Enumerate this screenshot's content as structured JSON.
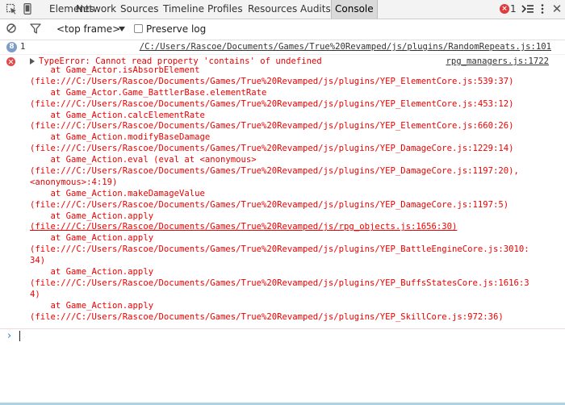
{
  "tabs": [
    {
      "label": "Elements"
    },
    {
      "label": "Network"
    },
    {
      "label": "Sources"
    },
    {
      "label": "Timeline"
    },
    {
      "label": "Profiles"
    },
    {
      "label": "Resources"
    },
    {
      "label": "Audits"
    },
    {
      "label": "Console"
    }
  ],
  "status": {
    "error_count": "1"
  },
  "toolbar": {
    "frame": "<top frame>",
    "preserve_log": "Preserve log"
  },
  "colors": {
    "error": "#e00000",
    "accent": "#2a7fd4",
    "active_tab": "#dadada"
  },
  "icons": [
    "inspect-icon",
    "mobile-icon",
    "error-icon",
    "drawer-icon",
    "dock-icon",
    "close-icon",
    "clear-icon",
    "filter-icon",
    "info-icon",
    "expand-icon",
    "prompt-icon"
  ],
  "messages": {
    "info": {
      "count": "1",
      "url": "/C:/Users/Rascoe/Documents/Games/True%20Revamped/js/plugins/RandomRepeats.js:101"
    },
    "error": {
      "first_line": "TypeError: Cannot read property 'contains' of undefined",
      "source": "rpg_managers.js:1722",
      "stack": [
        "    at Game_Actor.isAbsorbElement",
        "(file:///C:/Users/Rascoe/Documents/Games/True%20Revamped/js/plugins/YEP_ElementCore.js:539:37)",
        "    at Game_Actor.Game_BattlerBase.elementRate",
        "(file:///C:/Users/Rascoe/Documents/Games/True%20Revamped/js/plugins/YEP_ElementCore.js:453:12)",
        "    at Game_Action.calcElementRate",
        "(file:///C:/Users/Rascoe/Documents/Games/True%20Revamped/js/plugins/YEP_ElementCore.js:660:26)",
        "    at Game_Action.modifyBaseDamage",
        "(file:///C:/Users/Rascoe/Documents/Games/True%20Revamped/js/plugins/YEP_DamageCore.js:1229:14)",
        "    at Game_Action.eval (eval at <anonymous>",
        "(file:///C:/Users/Rascoe/Documents/Games/True%20Revamped/js/plugins/YEP_DamageCore.js:1197:20),",
        "<anonymous>:4:19)",
        "    at Game_Action.makeDamageValue",
        "(file:///C:/Users/Rascoe/Documents/Games/True%20Revamped/js/plugins/YEP_DamageCore.js:1197:5)",
        "    at Game_Action.apply",
        "(file:///C:/Users/Rascoe/Documents/Games/True%20Revamped/js/rpg_objects.js:1656:30)",
        "    at Game_Action.apply",
        "(file:///C:/Users/Rascoe/Documents/Games/True%20Revamped/js/plugins/YEP_BattleEngineCore.js:3010:",
        "34)",
        "    at Game_Action.apply",
        "(file:///C:/Users/Rascoe/Documents/Games/True%20Revamped/js/plugins/YEP_BuffsStatesCore.js:1616:3",
        "4)",
        "    at Game_Action.apply",
        "(file:///C:/Users/Rascoe/Documents/Games/True%20Revamped/js/plugins/YEP_SkillCore.js:972:36)"
      ]
    }
  },
  "prompt": {
    "symbol": "›"
  }
}
